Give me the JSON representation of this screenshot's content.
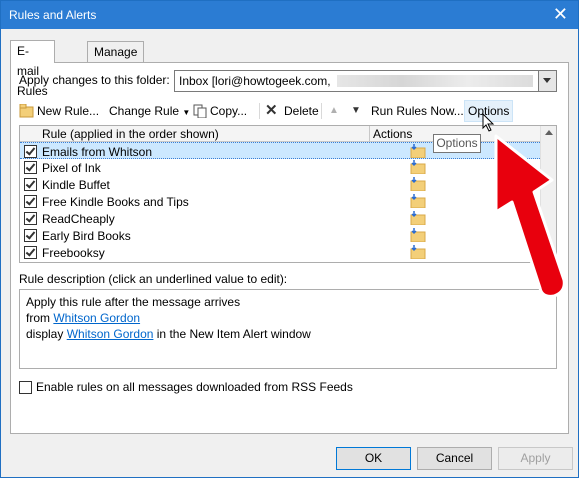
{
  "window": {
    "title": "Rules and Alerts",
    "close_glyph": "✕"
  },
  "tabs": [
    {
      "label": "E-mail Rules"
    },
    {
      "label": "Manage Alerts"
    }
  ],
  "folder": {
    "label": "Apply changes to this folder:",
    "value": "Inbox [lori@howtogeek.com,"
  },
  "toolbar": {
    "new_rule": "New Rule...",
    "change_rule": "Change Rule",
    "copy": "Copy...",
    "delete": "Delete",
    "run_rules": "Run Rules Now...",
    "options": "Options"
  },
  "grid": {
    "col_rule": "Rule (applied in the order shown)",
    "col_actions": "Actions",
    "rows": [
      {
        "name": "Emails from Whitson",
        "checked": true,
        "selected": true
      },
      {
        "name": "Pixel of Ink",
        "checked": true
      },
      {
        "name": "Kindle Buffet",
        "checked": true
      },
      {
        "name": "Free Kindle Books and Tips",
        "checked": true
      },
      {
        "name": "ReadCheaply",
        "checked": true
      },
      {
        "name": "Early Bird Books",
        "checked": true
      },
      {
        "name": "Freebooksy",
        "checked": true
      }
    ]
  },
  "description": {
    "label": "Rule description (click an underlined value to edit):",
    "line1": "Apply this rule after the message arrives",
    "line2_prefix": "from",
    "line2_link": "Whitson Gordon",
    "line3_prefix": "display",
    "line3_link": "Whitson Gordon",
    "line3_suffix": "in the New Item Alert window"
  },
  "rss": {
    "label": "Enable rules on all messages downloaded from RSS Feeds",
    "checked": false
  },
  "buttons": {
    "ok": "OK",
    "cancel": "Cancel",
    "apply": "Apply"
  },
  "tooltip": "Options",
  "colors": {
    "titlebar": "#2b7cd3",
    "selection": "#cce8ff",
    "link": "#0066cc",
    "annotation_arrow": "#e8000d"
  }
}
